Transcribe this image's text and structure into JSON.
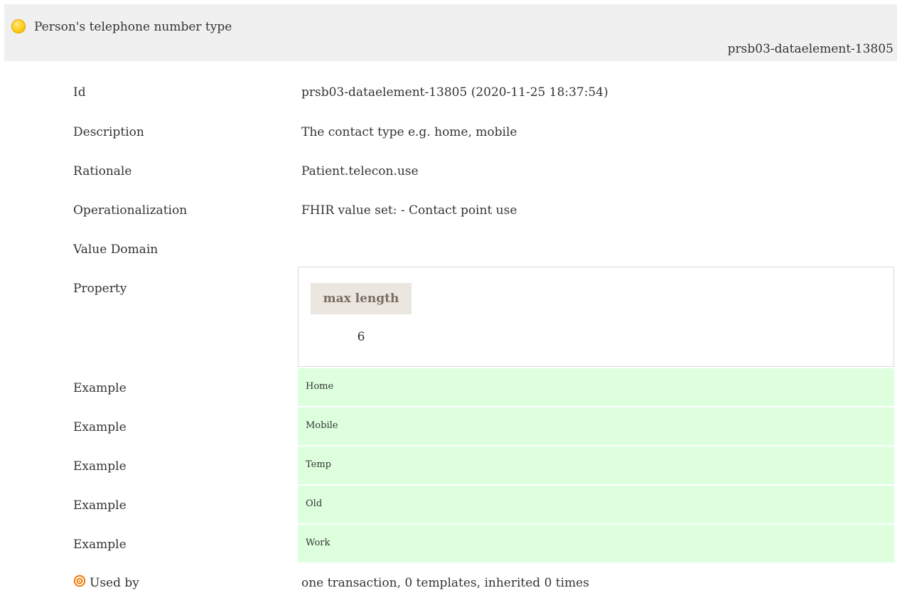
{
  "header": {
    "title": "Person's telephone number type",
    "id": "prsb03-dataelement-13805"
  },
  "rows": {
    "id": {
      "label": "Id",
      "value": "prsb03-dataelement-13805 (2020-11-25 18:37:54)"
    },
    "description": {
      "label": "Description",
      "value": "The contact type e.g. home, mobile"
    },
    "rationale": {
      "label": "Rationale",
      "value": "Patient.telecon.use"
    },
    "operationalization": {
      "label": "Operationalization",
      "value": "FHIR value set: - Contact point use"
    },
    "value_domain": {
      "label": "Value Domain"
    },
    "property": {
      "label": "Property",
      "header": "max length",
      "value": "6"
    },
    "used_by": {
      "label": "Used by",
      "value": "one transaction, 0 templates, inherited 0 times"
    }
  },
  "examples": [
    {
      "label": "Example",
      "value": "Home"
    },
    {
      "label": "Example",
      "value": "Mobile"
    },
    {
      "label": "Example",
      "value": "Temp"
    },
    {
      "label": "Example",
      "value": "Old"
    },
    {
      "label": "Example",
      "value": "Work"
    }
  ],
  "icons": {
    "status": "status-circle-yellow-icon",
    "used_by": "target-icon"
  },
  "colors": {
    "status": "#ffd21f",
    "header_bg": "#f0f0f0",
    "example_bg": "#ddffdd",
    "property_header_bg": "#ebe7e0",
    "used_by_icon": "#f07a00"
  }
}
